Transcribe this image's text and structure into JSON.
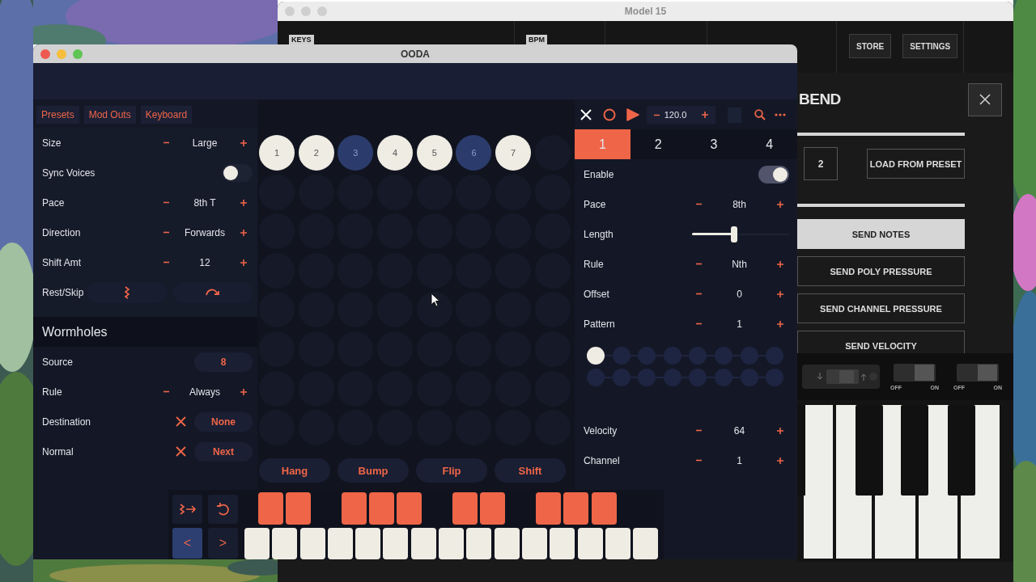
{
  "back_window": {
    "title": "Model 15",
    "toolbar_labels": [
      "KEYS",
      "BPM"
    ],
    "toolbar_buttons": [
      "STORE",
      "SETTINGS"
    ],
    "panel": {
      "title": "BEND",
      "number": "2",
      "load_button": "LOAD FROM PRESET",
      "send_options": [
        {
          "label": "SEND NOTES",
          "selected": true
        },
        {
          "label": "SEND POLY PRESSURE",
          "selected": false
        },
        {
          "label": "SEND CHANNEL PRESSURE",
          "selected": false
        },
        {
          "label": "SEND VELOCITY",
          "selected": false
        }
      ]
    },
    "switches": [
      {
        "off_label": "OFF",
        "on_label": "ON"
      },
      {
        "off_label": "OFF",
        "on_label": "ON"
      }
    ]
  },
  "window": {
    "title": "OODA"
  },
  "left_tabs": [
    "Presets",
    "Mod Outs",
    "Keyboard"
  ],
  "settings": [
    {
      "kind": "stepper",
      "label": "Size",
      "value": "Large"
    },
    {
      "kind": "toggle",
      "label": "Sync Voices",
      "on": false
    },
    {
      "kind": "stepper",
      "label": "Pace",
      "value": "8th T"
    },
    {
      "kind": "stepper",
      "label": "Direction",
      "value": "Forwards"
    },
    {
      "kind": "stepper",
      "label": "Shift Amt",
      "value": "12"
    },
    {
      "kind": "icon_pair",
      "label": "Rest/Skip"
    }
  ],
  "wormholes": {
    "title": "Wormholes",
    "rows": [
      {
        "kind": "pill",
        "label": "Source",
        "value": "8"
      },
      {
        "kind": "stepper",
        "label": "Rule",
        "value": "Always"
      },
      {
        "kind": "clear_pill",
        "label": "Destination",
        "value": "None"
      },
      {
        "kind": "clear_pill",
        "label": "Normal",
        "value": "Next"
      }
    ]
  },
  "voices": [
    {
      "label": "1",
      "active": true
    },
    {
      "label": "2",
      "active": true
    },
    {
      "label": "3",
      "active": false
    },
    {
      "label": "4",
      "active": true
    },
    {
      "label": "5",
      "active": true
    },
    {
      "label": "6",
      "active": false
    },
    {
      "label": "7",
      "active": true
    }
  ],
  "actions": [
    "Hang",
    "Bump",
    "Flip",
    "Shift"
  ],
  "transport": {
    "tempo": "120.0"
  },
  "voice_tabs": [
    {
      "label": "1",
      "selected": true
    },
    {
      "label": "2",
      "selected": false
    },
    {
      "label": "3",
      "selected": false
    },
    {
      "label": "4",
      "selected": false
    }
  ],
  "voice_settings": [
    {
      "kind": "toggle",
      "label": "Enable",
      "on": true
    },
    {
      "kind": "stepper",
      "label": "Pace",
      "value": "8th"
    },
    {
      "kind": "slider",
      "label": "Length",
      "level": 0.43
    },
    {
      "kind": "stepper",
      "label": "Rule",
      "value": "Nth"
    },
    {
      "kind": "stepper",
      "label": "Offset",
      "value": "0"
    },
    {
      "kind": "stepper",
      "label": "Pattern",
      "value": "1"
    },
    {
      "kind": "steps",
      "steps": [
        {
          "selected": true
        },
        {
          "selected": false
        },
        {
          "selected": false
        },
        {
          "selected": false
        },
        {
          "selected": false
        },
        {
          "selected": false
        },
        {
          "selected": false
        },
        {
          "selected": false
        },
        {
          "selected": false
        },
        {
          "selected": false
        },
        {
          "selected": false
        },
        {
          "selected": false
        },
        {
          "selected": false
        },
        {
          "selected": false
        },
        {
          "selected": false
        },
        {
          "selected": false
        }
      ]
    },
    {
      "kind": "stepper",
      "label": "Velocity",
      "value": "64"
    },
    {
      "kind": "stepper",
      "label": "Channel",
      "value": "1"
    }
  ],
  "keyboard_nav": [
    {
      "label": "<",
      "selected": true
    },
    {
      "label": ">",
      "selected": false
    }
  ]
}
